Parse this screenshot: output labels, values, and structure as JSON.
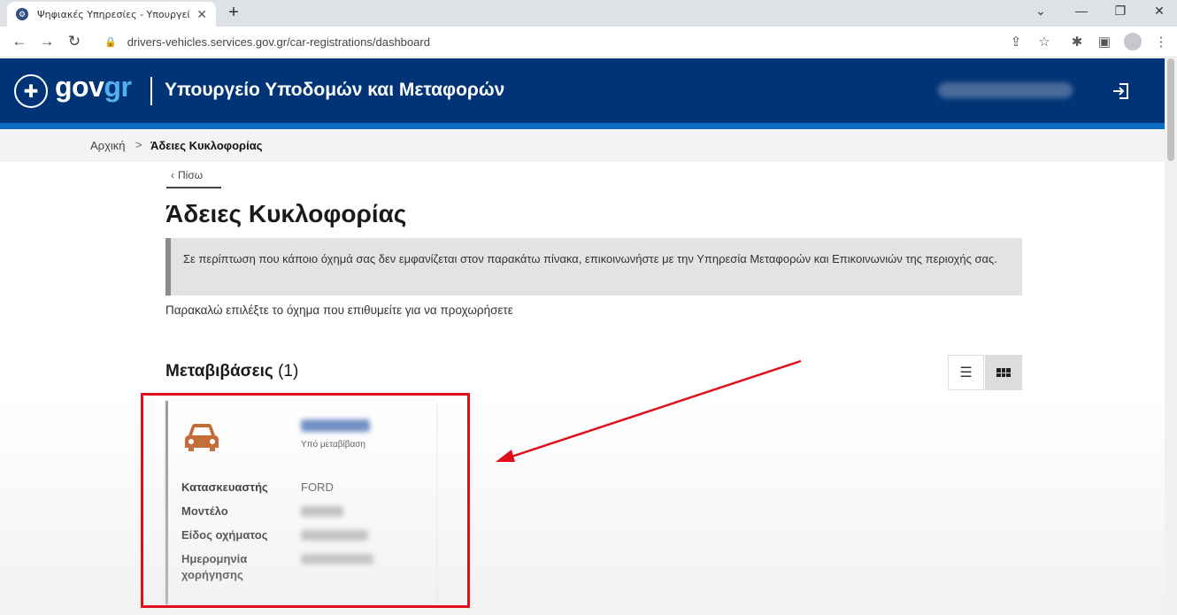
{
  "browser": {
    "tab_title": "Ψηφιακές Υπηρεσίες - Υπουργεί",
    "tab_close": "✕",
    "new_tab": "+",
    "url": "drivers-vehicles.services.gov.gr/car-registrations/dashboard"
  },
  "header": {
    "logo_main": "gov",
    "logo_accent": "gr",
    "ministry": "Υπουργείο Υποδομών και Μεταφορών"
  },
  "breadcrumb": {
    "home": "Αρχική",
    "separator": ">",
    "current": "Άδειες Κυκλοφορίας"
  },
  "main": {
    "back_label": "Πίσω",
    "title": "Άδειες Κυκλοφορίας",
    "notice": "Σε περίπτωση που κάποιο όχημά σας δεν εμφανίζεται στον παρακάτω πίνακα, επικοινωνήστε με την Υπηρεσία Μεταφορών και Επικοινωνιών της περιοχής σας.",
    "instruction": "Παρακαλώ επιλέξτε το όχημα που επιθυμείτε για να προχωρήσετε",
    "section_title": "Μεταβιβάσεις",
    "section_count": "(1)"
  },
  "card": {
    "status": "Υπό μεταβίβαση",
    "labels": {
      "manufacturer": "Κατασκευαστής",
      "model": "Μοντέλο",
      "vehicle_type": "Είδος οχήματος",
      "issue_date_line1": "Ημερομηνία",
      "issue_date_line2": "χορήγησης"
    },
    "values": {
      "manufacturer": "FORD"
    }
  },
  "colors": {
    "header_bg": "#003476",
    "header_stripe": "#0d6ec2",
    "car_icon": "#c0632a",
    "annotation_red": "#e0101a"
  }
}
